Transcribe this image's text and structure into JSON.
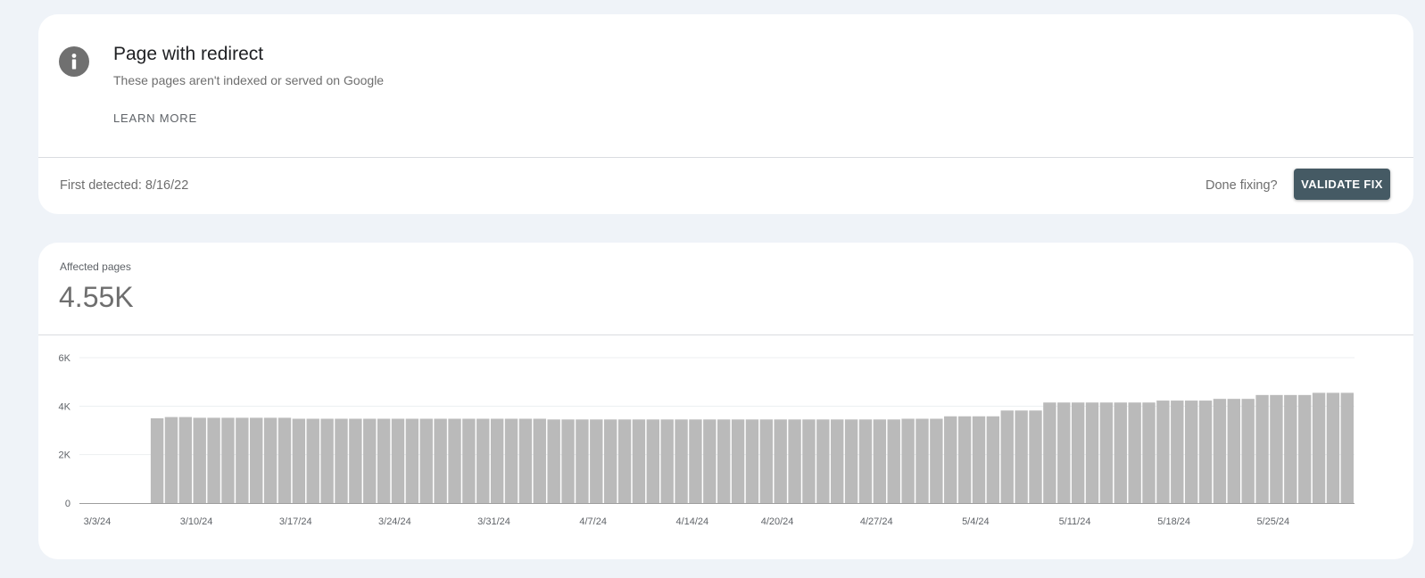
{
  "issue": {
    "title": "Page with redirect",
    "subtitle": "These pages aren't indexed or served on Google",
    "learn_more": "LEARN MORE",
    "first_detected": "First detected: 8/16/22",
    "done_fixing": "Done fixing?",
    "validate_label": "VALIDATE FIX",
    "icon": "info-icon"
  },
  "summary": {
    "label": "Affected pages",
    "value": "4.55K"
  },
  "chart_data": {
    "type": "bar",
    "ylim": [
      0,
      6000
    ],
    "y_ticks": [
      "0",
      "2K",
      "4K",
      "6K"
    ],
    "y_tick_values": [
      0,
      2000,
      4000,
      6000
    ],
    "x_tick_labels": [
      "3/3/24",
      "3/10/24",
      "3/17/24",
      "3/24/24",
      "3/31/24",
      "4/7/24",
      "4/14/24",
      "4/20/24",
      "4/27/24",
      "5/4/24",
      "5/11/24",
      "5/18/24",
      "5/25/24"
    ],
    "x_tick_indices": [
      0,
      7,
      14,
      21,
      28,
      35,
      42,
      48,
      55,
      62,
      69,
      76,
      83
    ],
    "bar_color": "#bababa",
    "grid": true,
    "values": [
      0,
      0,
      0,
      0,
      0,
      3500,
      3550,
      3550,
      3520,
      3520,
      3520,
      3520,
      3520,
      3520,
      3520,
      3480,
      3480,
      3480,
      3480,
      3480,
      3480,
      3480,
      3480,
      3480,
      3480,
      3480,
      3480,
      3480,
      3480,
      3480,
      3480,
      3480,
      3480,
      3450,
      3450,
      3450,
      3450,
      3450,
      3450,
      3450,
      3450,
      3450,
      3450,
      3450,
      3450,
      3450,
      3450,
      3450,
      3450,
      3450,
      3450,
      3450,
      3450,
      3450,
      3450,
      3450,
      3450,
      3450,
      3480,
      3480,
      3480,
      3580,
      3580,
      3580,
      3580,
      3820,
      3820,
      3820,
      4150,
      4150,
      4150,
      4150,
      4150,
      4150,
      4150,
      4150,
      4230,
      4230,
      4230,
      4230,
      4300,
      4300,
      4300,
      4460,
      4460,
      4460,
      4460,
      4550,
      4550,
      4550
    ]
  }
}
